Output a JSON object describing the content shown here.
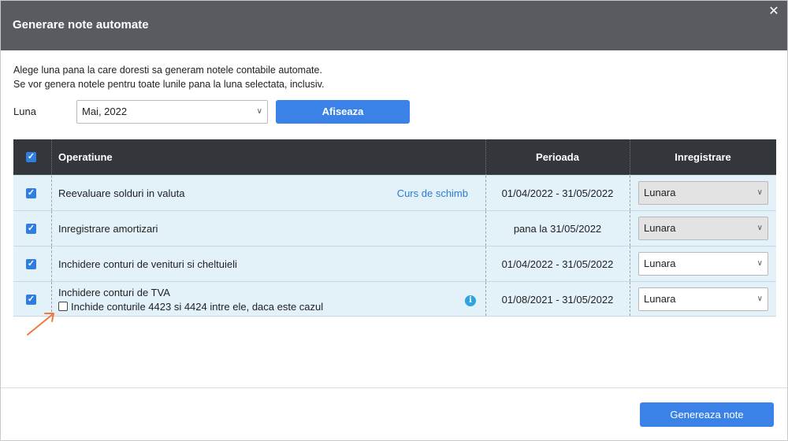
{
  "dialog": {
    "title": "Generare note automate",
    "close_icon": "close-icon"
  },
  "intro": {
    "line1": "Alege luna pana la care doresti sa generam notele contabile automate.",
    "line2": "Se vor genera notele pentru toate lunile pana la luna selectata, inclusiv."
  },
  "filter": {
    "luna_label": "Luna",
    "luna_value": "Mai, 2022",
    "afiseaza_label": "Afiseaza"
  },
  "table": {
    "headers": {
      "operatiune": "Operatiune",
      "perioada": "Perioada",
      "inregistrare": "Inregistrare"
    },
    "rows": [
      {
        "operatiune": "Reevaluare solduri in valuta",
        "link": "Curs de schimb",
        "perioada": "01/04/2022 - 31/05/2022",
        "inregistrare": "Lunara",
        "checked": true,
        "select_disabled": true
      },
      {
        "operatiune": "Inregistrare amortizari",
        "perioada": "pana la 31/05/2022",
        "inregistrare": "Lunara",
        "checked": true,
        "select_disabled": true
      },
      {
        "operatiune": "Inchidere conturi de venituri si cheltuieli",
        "perioada": "01/04/2022 - 31/05/2022",
        "inregistrare": "Lunara",
        "checked": true,
        "select_disabled": false
      },
      {
        "operatiune": "Inchidere conturi de TVA",
        "sub_option": "Inchide conturile 4423 si 4424 intre ele, daca este cazul",
        "sub_option_checked": false,
        "perioada": "01/08/2021 - 31/05/2022",
        "inregistrare": "Lunara",
        "checked": true,
        "select_disabled": false,
        "info_icon": "info-icon"
      }
    ]
  },
  "footer": {
    "genereaza_label": "Genereaza note"
  },
  "colors": {
    "header_bg": "#595b60",
    "table_header_bg": "#33363b",
    "row_bg": "#e3f1f9",
    "primary": "#3b82e8",
    "link": "#2a7bd4",
    "arrow": "#f07a3a"
  }
}
